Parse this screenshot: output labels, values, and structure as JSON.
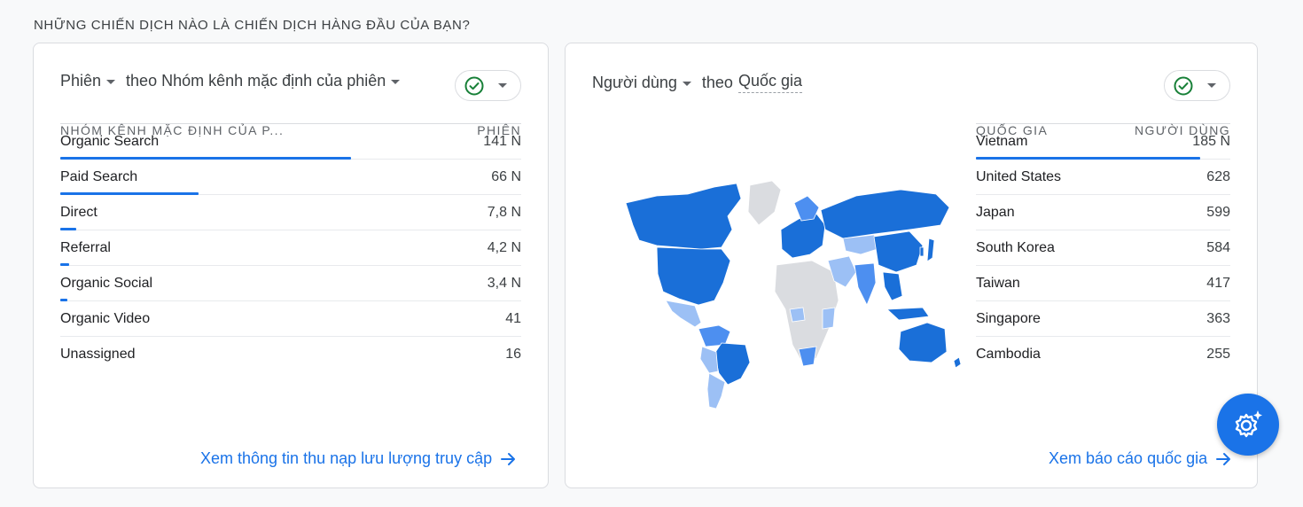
{
  "section_title": "NHỮNG CHIẾN DỊCH NÀO LÀ CHIẾN DỊCH HÀNG ĐẦU CỦA BẠN?",
  "left_card": {
    "metric": "Phiên",
    "dimension": "theo Nhóm kênh mặc định của phiên",
    "col_dimension": "NHÓM KÊNH MẶC ĐỊNH CỦA P...",
    "col_metric": "PHIÊN",
    "rows": [
      {
        "label": "Organic Search",
        "value": "141 N",
        "share": 0.63
      },
      {
        "label": "Paid Search",
        "value": "66 N",
        "share": 0.3
      },
      {
        "label": "Direct",
        "value": "7,8 N",
        "share": 0.035
      },
      {
        "label": "Referral",
        "value": "4,2 N",
        "share": 0.019
      },
      {
        "label": "Organic Social",
        "value": "3,4 N",
        "share": 0.015
      },
      {
        "label": "Organic Video",
        "value": "41",
        "share": 0
      },
      {
        "label": "Unassigned",
        "value": "16",
        "share": 0
      }
    ],
    "link": "Xem thông tin thu nạp lưu lượng truy cập"
  },
  "right_card": {
    "metric": "Người dùng",
    "dimension_prefix": "theo",
    "dimension": "Quốc gia",
    "col_dimension": "QUỐC GIA",
    "col_metric": "NGƯỜI DÙNG",
    "rows": [
      {
        "label": "Vietnam",
        "value": "185 N",
        "share": 0.88
      },
      {
        "label": "United States",
        "value": "628",
        "share": 0
      },
      {
        "label": "Japan",
        "value": "599",
        "share": 0
      },
      {
        "label": "South Korea",
        "value": "584",
        "share": 0
      },
      {
        "label": "Taiwan",
        "value": "417",
        "share": 0
      },
      {
        "label": "Singapore",
        "value": "363",
        "share": 0
      },
      {
        "label": "Cambodia",
        "value": "255",
        "share": 0
      }
    ],
    "link": "Xem báo cáo quốc gia"
  },
  "colors": {
    "accent": "#1a73e8",
    "check": "#188038",
    "map_high": "#1a6fd8",
    "map_mid": "#4d8ff0",
    "map_low": "#9cc0f5",
    "map_none": "#dadce0"
  },
  "icons": {
    "check": "check-circle-icon",
    "arrow": "arrow-right-icon",
    "fab": "settings-sparkle-icon"
  }
}
